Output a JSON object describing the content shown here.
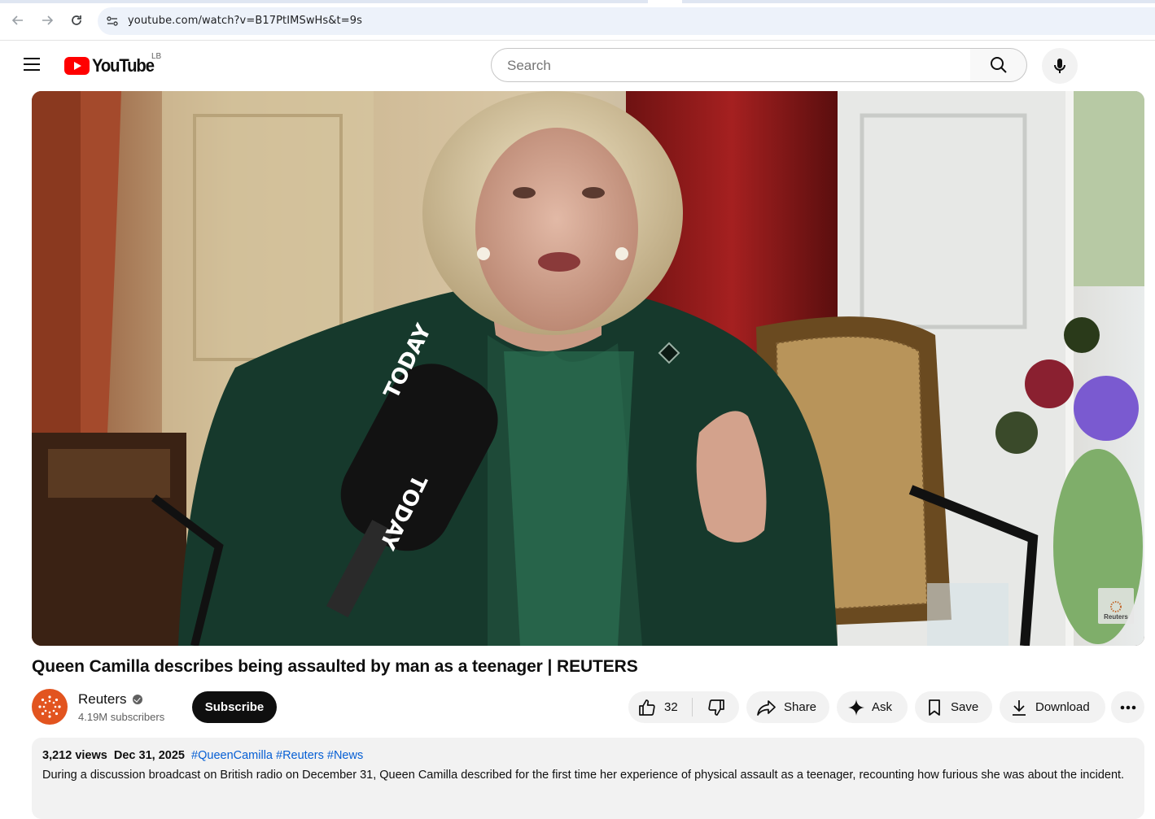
{
  "browser": {
    "url": "youtube.com/watch?v=B17PtIMSwHs&t=9s"
  },
  "masthead": {
    "logo_text": "YouTube",
    "country_code": "LB",
    "search_placeholder": "Search"
  },
  "player": {
    "watermark_text": "Reuters",
    "microphone_text": "TODAY"
  },
  "video": {
    "title": "Queen Camilla describes being assaulted by man as a teenager | REUTERS"
  },
  "channel": {
    "name": "Reuters",
    "subscribers": "4.19M subscribers",
    "subscribe_label": "Subscribe"
  },
  "actions": {
    "like_count": "32",
    "share_label": "Share",
    "ask_label": "Ask",
    "save_label": "Save",
    "download_label": "Download"
  },
  "description": {
    "views": "3,212 views",
    "date": "Dec 31, 2025",
    "hashtags": [
      "#QueenCamilla",
      "#Reuters",
      "#News"
    ],
    "text": "During a discussion broadcast on British radio on December 31, Queen Camilla described for the first time her experience of physical assault as a teenager, recounting how furious she was about the incident."
  },
  "colors": {
    "brand_red": "#ff0000",
    "link_blue": "#065fd4",
    "reuters_orange": "#e2541f"
  }
}
